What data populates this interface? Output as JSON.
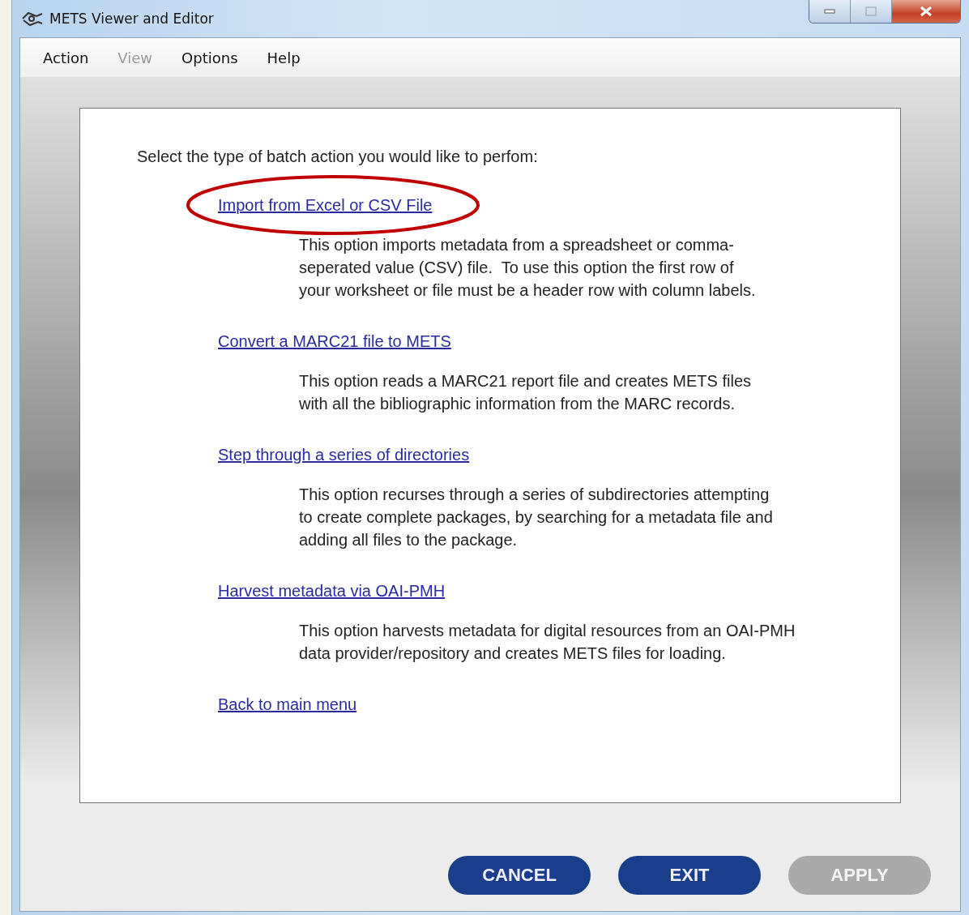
{
  "window": {
    "title": "METS Viewer and Editor"
  },
  "menu": [
    {
      "label": "Action",
      "disabled": false
    },
    {
      "label": "View",
      "disabled": true
    },
    {
      "label": "Options",
      "disabled": false
    },
    {
      "label": "Help",
      "disabled": false
    }
  ],
  "prompt": "Select the type of batch action you would like to perfom:",
  "options": [
    {
      "link": "Import from Excel or CSV File",
      "highlighted": true,
      "description": "This option imports metadata from a spreadsheet or comma-\nseperated value (CSV) file.  To use this option the first row of\nyour worksheet or file must be a header row with column labels."
    },
    {
      "link": "Convert a MARC21 file to METS",
      "highlighted": false,
      "description": "This option reads a MARC21 report file and creates METS files\nwith all the bibliographic information from the MARC records."
    },
    {
      "link": "Step through a series of directories",
      "highlighted": false,
      "description": "This option recurses through a series of subdirectories attempting\nto create complete packages, by searching for a metadata file and\nadding all files to the package."
    },
    {
      "link": "Harvest metadata via OAI-PMH",
      "highlighted": false,
      "description": "This option harvests metadata for digital resources from an OAI-PMH\ndata provider/repository and creates METS files for loading."
    },
    {
      "link": "Back to main menu",
      "highlighted": false
    }
  ],
  "buttons": [
    {
      "label": "CANCEL",
      "disabled": false
    },
    {
      "label": "EXIT",
      "disabled": false
    },
    {
      "label": "APPLY",
      "disabled": true
    }
  ]
}
